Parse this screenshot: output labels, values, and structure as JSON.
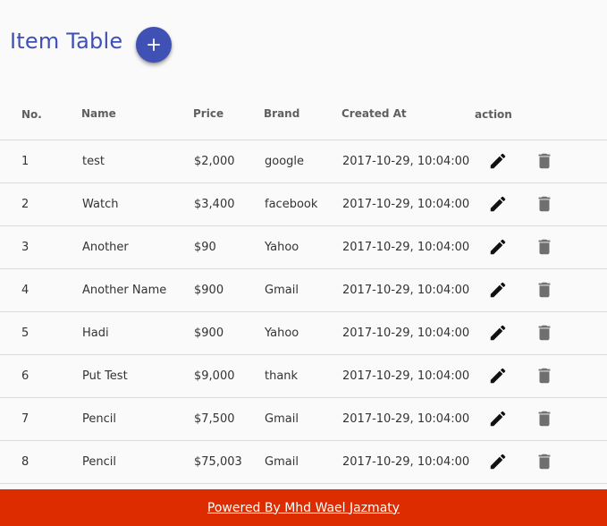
{
  "header": {
    "title": "Item Table",
    "add_button_icon": "plus-icon"
  },
  "table": {
    "columns": [
      "No.",
      "Name",
      "Price",
      "Brand",
      "Created At",
      "action"
    ],
    "rows": [
      {
        "no": "1",
        "name": "test",
        "price": "$2,000",
        "brand": "google",
        "created": "2017-10-29, 10:04:00"
      },
      {
        "no": "2",
        "name": "Watch",
        "price": "$3,400",
        "brand": "facebook",
        "created": "2017-10-29, 10:04:00"
      },
      {
        "no": "3",
        "name": "Another",
        "price": "$90",
        "brand": "Yahoo",
        "created": "2017-10-29, 10:04:00"
      },
      {
        "no": "4",
        "name": "Another Name",
        "price": "$900",
        "brand": "Gmail",
        "created": "2017-10-29, 10:04:00"
      },
      {
        "no": "5",
        "name": "Hadi",
        "price": "$900",
        "brand": "Yahoo",
        "created": "2017-10-29, 10:04:00"
      },
      {
        "no": "6",
        "name": "Put Test",
        "price": "$9,000",
        "brand": "thank",
        "created": "2017-10-29, 10:04:00"
      },
      {
        "no": "7",
        "name": "Pencil",
        "price": "$7,500",
        "brand": "Gmail",
        "created": "2017-10-29, 10:04:00"
      },
      {
        "no": "8",
        "name": "Pencil",
        "price": "$75,003",
        "brand": "Gmail",
        "created": "2017-10-29, 10:04:00"
      }
    ],
    "edit_icon": "pencil-icon",
    "delete_icon": "trash-icon"
  },
  "footer": {
    "text": "Powered By Mhd Wael Jazmaty"
  },
  "colors": {
    "accent": "#3f51b5",
    "footer_bg": "#dd2c00",
    "delete_icon": "#6f6f6f"
  }
}
